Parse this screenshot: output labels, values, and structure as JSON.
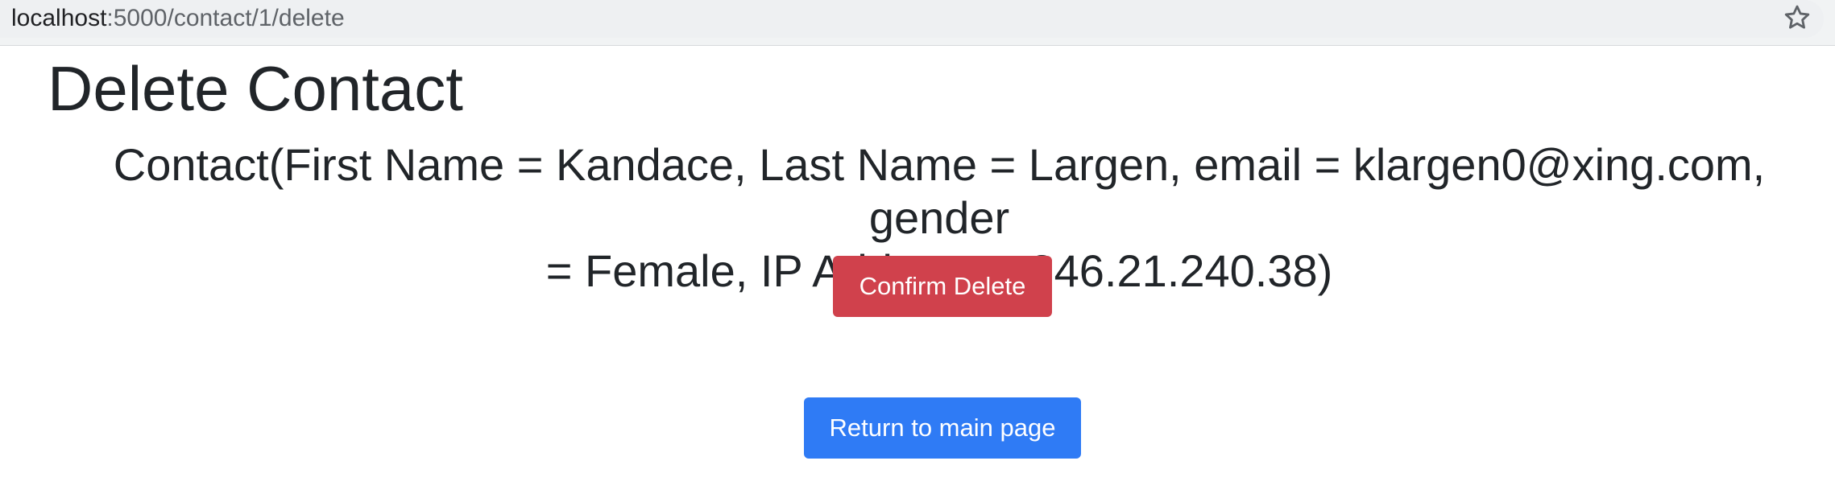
{
  "browser": {
    "url_host": "localhost",
    "url_path": ":5000/contact/1/delete",
    "bookmark_icon": "star-icon"
  },
  "page": {
    "title": "Delete Contact",
    "contact_line_1": "Contact(First Name = Kandace, Last Name = Largen, email = klargen0@xing.com, gender",
    "contact_line_2": "= Female, IP Address = 246.21.240.38)"
  },
  "actions": {
    "confirm_delete_label": "Confirm Delete",
    "return_label": "Return to main page"
  },
  "colors": {
    "danger": "#d0414c",
    "primary": "#2f7bf5"
  }
}
